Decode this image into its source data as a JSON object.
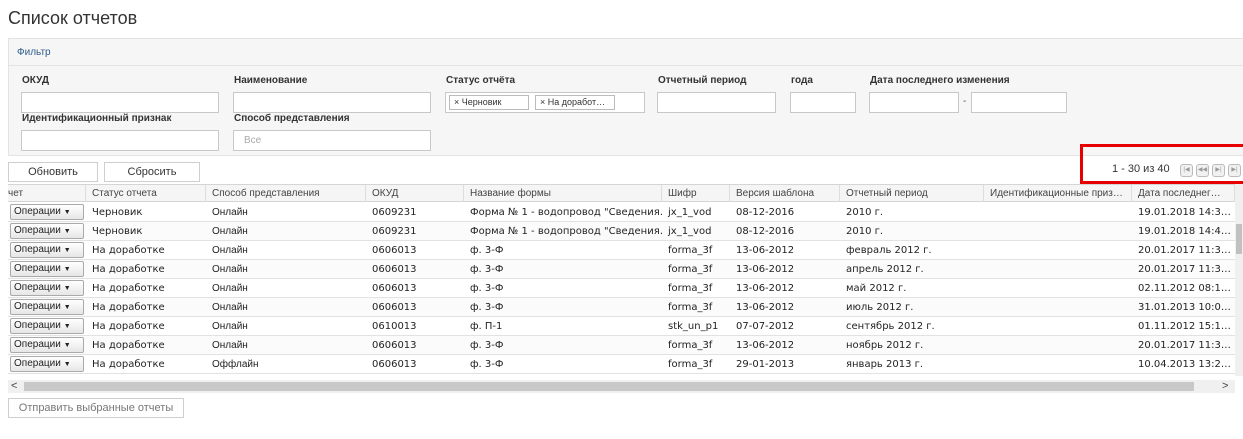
{
  "page_title": "Список отчетов",
  "filter": {
    "header": "Фильтр",
    "okud_label": "ОКУД",
    "okud_value": "",
    "name_label": "Наименование",
    "name_value": "",
    "status_label": "Статус отчёта",
    "status_tags": [
      "× Черновик",
      "× На доработ…"
    ],
    "period_label": "Отчетный период",
    "period_value": "",
    "year_label": "года",
    "year_value": "",
    "date_changed_label": "Дата последнего изменения",
    "date_from": "",
    "date_to": "",
    "date_separator": "-",
    "id_label": "Идентификационный признак",
    "id_value": "",
    "method_label": "Способ представления",
    "method_placeholder": "Все"
  },
  "buttons": {
    "refresh": "Обновить",
    "reset": "Сбросить",
    "send_selected": "Отправить выбранные отчеты"
  },
  "pager": {
    "text": "1 - 30 из 40",
    "icons": [
      "first-page-icon",
      "prev-page-icon",
      "next-page-icon",
      "last-page-icon"
    ]
  },
  "colors": {
    "highlight": "#e60000",
    "filter_link": "#2e5c8a"
  },
  "grid": {
    "columns": [
      "чет",
      "Статус отчета",
      "Способ представления",
      "ОКУД",
      "Название формы",
      "Шифр",
      "Версия шаблона",
      "Отчетный период",
      "Идентификационные приз…",
      "Дата последнег…"
    ],
    "ops_label": "Операции",
    "rows": [
      {
        "status": "Черновик",
        "method": "Онлайн",
        "okud": "0609231",
        "form": "Форма № 1 - водопровод \"Сведения…",
        "code": "jx_1_vod",
        "version": "08-12-2016",
        "period": "2010 г.",
        "ident": "",
        "changed": "19.01.2018 14:3…"
      },
      {
        "status": "Черновик",
        "method": "Онлайн",
        "okud": "0609231",
        "form": "Форма № 1 - водопровод \"Сведения…",
        "code": "jx_1_vod",
        "version": "08-12-2016",
        "period": "2010 г.",
        "ident": "",
        "changed": "19.01.2018 14:4…"
      },
      {
        "status": "На доработке",
        "method": "Онлайн",
        "okud": "0606013",
        "form": "ф. 3-Ф",
        "code": "forma_3f",
        "version": "13-06-2012",
        "period": "февраль 2012 г.",
        "ident": "",
        "changed": "20.01.2017 11:3…"
      },
      {
        "status": "На доработке",
        "method": "Онлайн",
        "okud": "0606013",
        "form": "ф. 3-Ф",
        "code": "forma_3f",
        "version": "13-06-2012",
        "period": "апрель 2012 г.",
        "ident": "",
        "changed": "20.01.2017 11:3…"
      },
      {
        "status": "На доработке",
        "method": "Онлайн",
        "okud": "0606013",
        "form": "ф. 3-Ф",
        "code": "forma_3f",
        "version": "13-06-2012",
        "period": "май 2012 г.",
        "ident": "",
        "changed": "02.11.2012 08:1…"
      },
      {
        "status": "На доработке",
        "method": "Онлайн",
        "okud": "0606013",
        "form": "ф. 3-Ф",
        "code": "forma_3f",
        "version": "13-06-2012",
        "period": "июль 2012 г.",
        "ident": "",
        "changed": "31.01.2013 10:0…"
      },
      {
        "status": "На доработке",
        "method": "Онлайн",
        "okud": "0610013",
        "form": "ф. П-1",
        "code": "stk_un_p1",
        "version": "07-07-2012",
        "period": "сентябрь 2012 г.",
        "ident": "",
        "changed": "01.11.2012 15:1…"
      },
      {
        "status": "На доработке",
        "method": "Онлайн",
        "okud": "0606013",
        "form": "ф. 3-Ф",
        "code": "forma_3f",
        "version": "13-06-2012",
        "period": "ноябрь 2012 г.",
        "ident": "",
        "changed": "20.01.2017 11:3…"
      },
      {
        "status": "На доработке",
        "method": "Оффлайн",
        "okud": "0606013",
        "form": "ф. 3-Ф",
        "code": "forma_3f",
        "version": "29-01-2013",
        "period": "январь 2013 г.",
        "ident": "",
        "changed": "10.04.2013 13:2…"
      }
    ]
  }
}
